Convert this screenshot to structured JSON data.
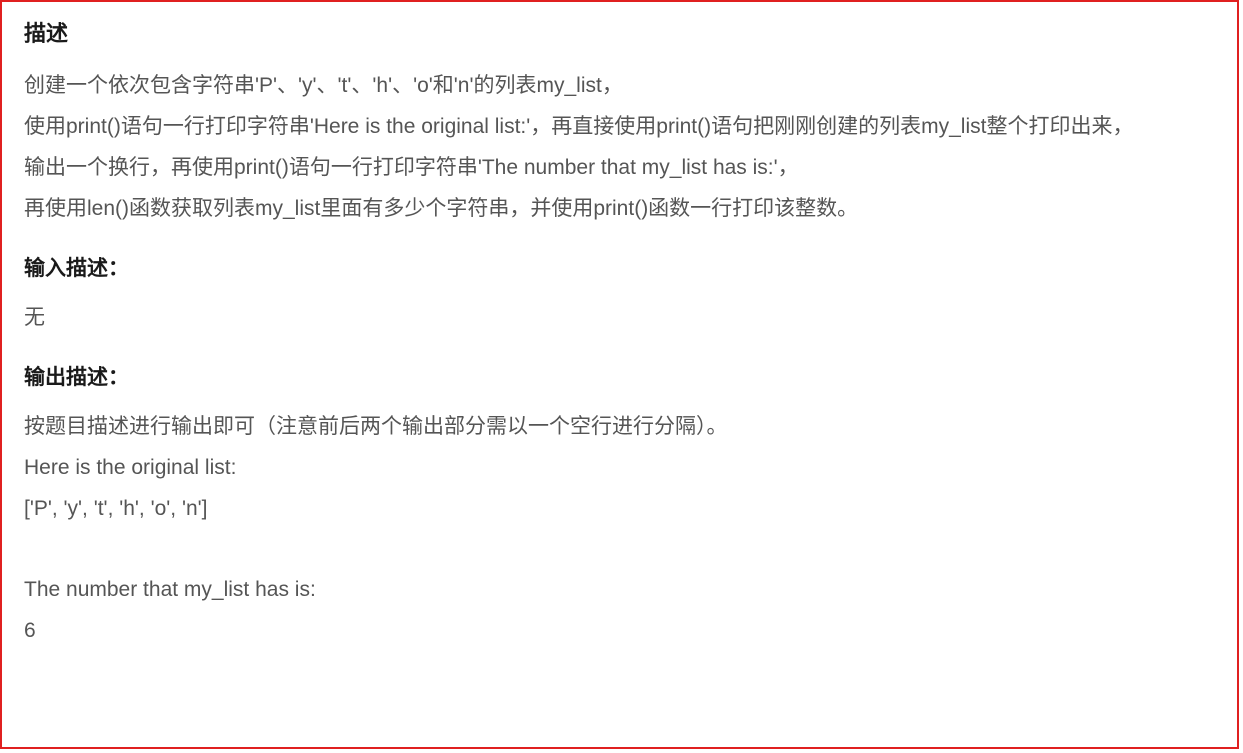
{
  "section": {
    "title": "描述",
    "body": "创建一个依次包含字符串'P'、'y'、't'、'h'、'o'和'n'的列表my_list，\n使用print()语句一行打印字符串'Here is the original list:'，再直接使用print()语句把刚刚创建的列表my_list整个打印出来，\n输出一个换行，再使用print()语句一行打印字符串'The number that my_list has is:'，\n再使用len()函数获取列表my_list里面有多少个字符串，并使用print()函数一行打印该整数。"
  },
  "input": {
    "title": "输入描述：",
    "body": "无"
  },
  "output": {
    "title": "输出描述：",
    "intro": "按题目描述进行输出即可（注意前后两个输出部分需以一个空行进行分隔）。",
    "lines": [
      "Here is the original list:",
      "['P', 'y', 't', 'h', 'o', 'n']",
      "",
      "The number that my_list has is:",
      "6"
    ]
  }
}
